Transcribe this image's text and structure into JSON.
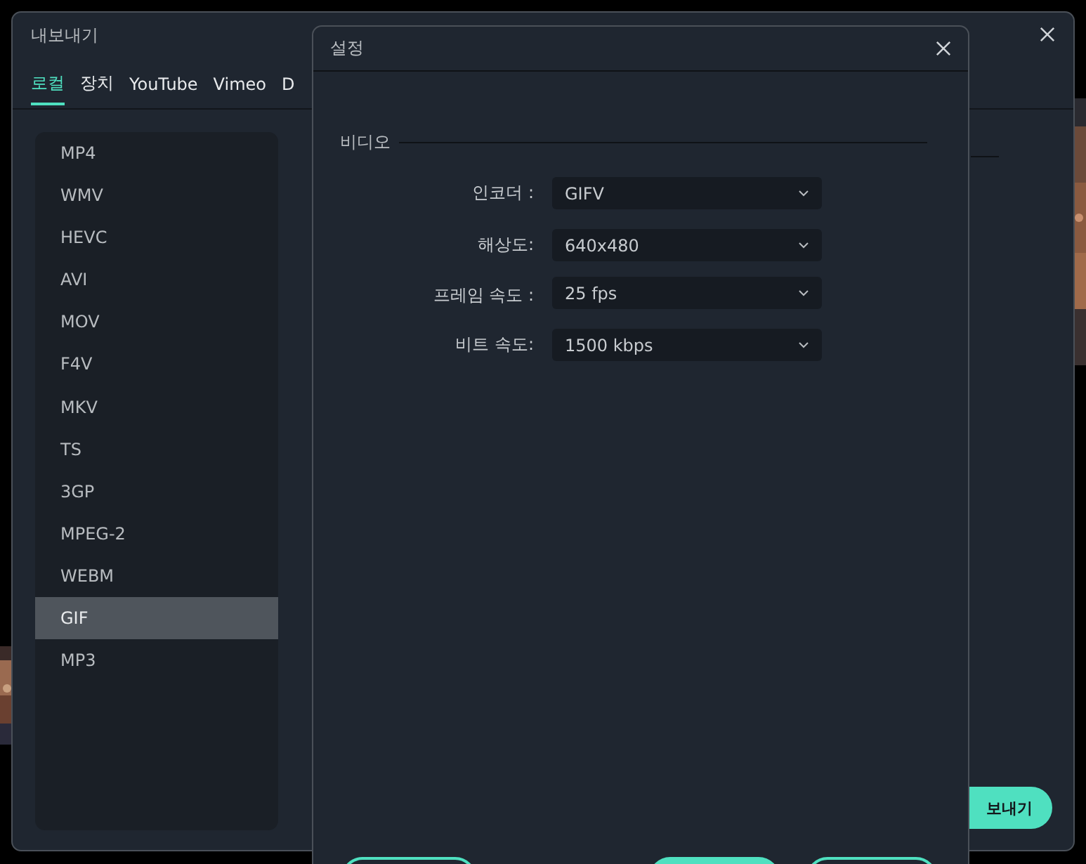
{
  "export_window": {
    "title": "내보내기",
    "tabs": [
      {
        "label": "로컬",
        "selected": true
      },
      {
        "label": "장치",
        "selected": false
      },
      {
        "label": "YouTube",
        "selected": false
      },
      {
        "label": "Vimeo",
        "selected": false
      },
      {
        "label": "D",
        "selected": false
      }
    ],
    "formats": [
      {
        "label": "MP4",
        "selected": false
      },
      {
        "label": "WMV",
        "selected": false
      },
      {
        "label": "HEVC",
        "selected": false
      },
      {
        "label": "AVI",
        "selected": false
      },
      {
        "label": "MOV",
        "selected": false
      },
      {
        "label": "F4V",
        "selected": false
      },
      {
        "label": "MKV",
        "selected": false
      },
      {
        "label": "TS",
        "selected": false
      },
      {
        "label": "3GP",
        "selected": false
      },
      {
        "label": "MPEG-2",
        "selected": false
      },
      {
        "label": "WEBM",
        "selected": false
      },
      {
        "label": "GIF",
        "selected": true
      },
      {
        "label": "MP3",
        "selected": false
      }
    ],
    "export_button": "보내기"
  },
  "settings_dialog": {
    "title": "설정",
    "section": "비디오",
    "fields": [
      {
        "label": "인코더 :",
        "value": "GIFV"
      },
      {
        "label": "해상도:",
        "value": "640x480"
      },
      {
        "label": "프레임 속도 :",
        "value": "25 fps"
      },
      {
        "label": "비트 속도:",
        "value": "1500 kbps"
      }
    ]
  }
}
